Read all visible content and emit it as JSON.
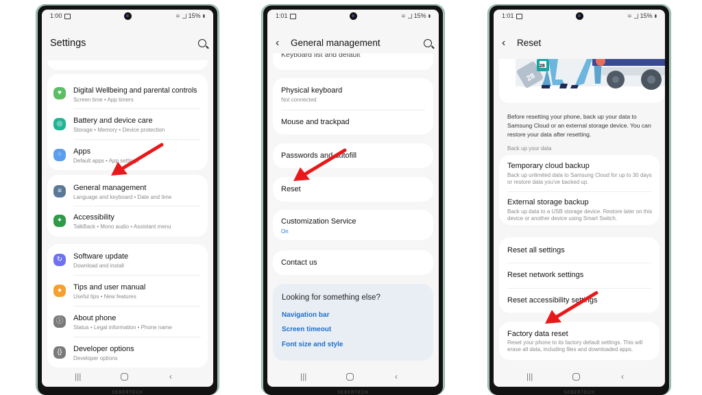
{
  "colors": {
    "accent_blue": "#1f6fc8",
    "annotation_arrow": "#e8191a",
    "phone_frame": "#a6c7b8",
    "screen_bg": "#f6f6f6",
    "card_bg": "#ffffff",
    "link_panel_bg": "#e9eef5"
  },
  "brand_text": "SEBERTECH",
  "screens": [
    {
      "status": {
        "time": "1:00",
        "battery": "15%"
      },
      "header": {
        "title": "Settings",
        "search_icon": "search-icon"
      },
      "items": [
        {
          "title": "Digital Wellbeing and parental controls",
          "subtitle": "Screen time  •  App timers",
          "icon": "wellbeing-icon",
          "icon_color": "#5bbd64"
        },
        {
          "title": "Battery and device care",
          "subtitle": "Storage  •  Memory  •  Device protection",
          "icon": "device-care-icon",
          "icon_color": "#20b394"
        },
        {
          "title": "Apps",
          "subtitle": "Default apps  •  App settings",
          "icon": "apps-icon",
          "icon_color": "#5b9ef0"
        },
        {
          "title": "General management",
          "subtitle": "Language and keyboard  •  Date and time",
          "icon": "general-management-icon",
          "icon_color": "#5a7898"
        },
        {
          "title": "Accessibility",
          "subtitle": "TalkBack  •  Mono audio  •  Assistant menu",
          "icon": "accessibility-icon",
          "icon_color": "#2f9a48"
        },
        {
          "title": "Software update",
          "subtitle": "Download and install",
          "icon": "software-update-icon",
          "icon_color": "#6f72f0"
        },
        {
          "title": "Tips and user manual",
          "subtitle": "Useful tips  •  New features",
          "icon": "tips-icon",
          "icon_color": "#f5a030"
        },
        {
          "title": "About phone",
          "subtitle": "Status  •  Legal information  •  Phone name",
          "icon": "about-phone-icon",
          "icon_color": "#7a7a7a"
        },
        {
          "title": "Developer options",
          "subtitle": "Developer options",
          "icon": "developer-options-icon",
          "icon_color": "#7a7a7a"
        }
      ]
    },
    {
      "status": {
        "time": "1:01",
        "battery": "15%"
      },
      "header": {
        "title": "General management",
        "back_icon": "back-icon",
        "search_icon": "search-icon"
      },
      "partial_item": "Keyboard list and default",
      "items": [
        {
          "title": "Physical keyboard",
          "subtitle": "Not connected"
        },
        {
          "title": "Mouse and trackpad"
        },
        {
          "title": "Passwords and autofill"
        },
        {
          "title": "Reset"
        },
        {
          "title": "Customization Service",
          "subtitle": "On"
        },
        {
          "title": "Contact us"
        }
      ],
      "looking_for": {
        "heading": "Looking for something else?",
        "links": [
          "Navigation bar",
          "Screen timeout",
          "Font size and style"
        ]
      }
    },
    {
      "status": {
        "time": "1:01",
        "battery": "15%"
      },
      "header": {
        "title": "Reset",
        "back_icon": "back-icon"
      },
      "illustration": {
        "calendar_label": "28"
      },
      "description": "Before resetting your phone, back up your data to Samsung Cloud or an external storage device. You can restore your data after resetting.",
      "backup_section": "Back up your data",
      "backup_items": [
        {
          "title": "Temporary cloud backup",
          "subtitle": "Back up unlimited data to Samsung Cloud for up to 30 days or restore data you've backed up."
        },
        {
          "title": "External storage backup",
          "subtitle": "Back up data to a USB storage device. Restore later on this device or another device using Smart Switch."
        }
      ],
      "reset_items": [
        {
          "title": "Reset all settings"
        },
        {
          "title": "Reset network settings"
        },
        {
          "title": "Reset accessibility settings"
        }
      ],
      "factory_reset": {
        "title": "Factory data reset",
        "subtitle": "Reset your phone to its factory default settings. This will erase all data, including files and downloaded apps."
      }
    }
  ]
}
